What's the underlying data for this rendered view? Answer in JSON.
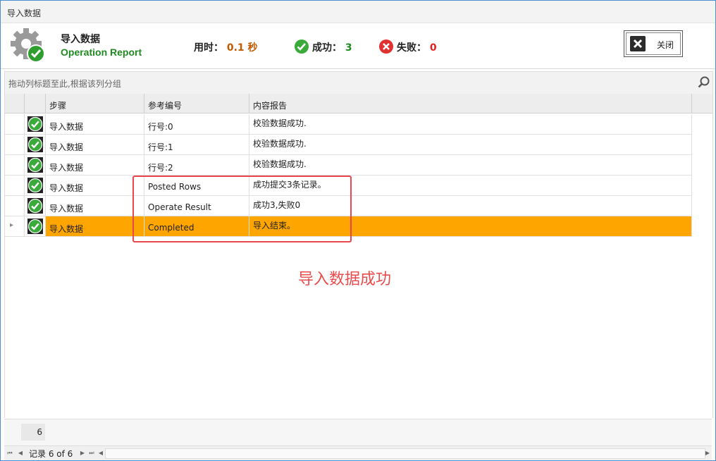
{
  "window": {
    "title": "导入数据"
  },
  "header": {
    "title": "导入数据",
    "subtitle": "Operation Report",
    "time_label": "用时：",
    "time_value": "0.1 秒",
    "success_label": "成功：",
    "success_value": "3",
    "fail_label": "失败：",
    "fail_value": "0",
    "close_label": "关闭"
  },
  "groupbar": {
    "hint": "拖动列标题至此,根据该列分组"
  },
  "grid": {
    "columns": [
      "步骤",
      "参考编号",
      "内容报告"
    ],
    "rows": [
      {
        "step": "导入数据",
        "ref": "行号:0",
        "report": "校验数据成功."
      },
      {
        "step": "导入数据",
        "ref": "行号:1",
        "report": "校验数据成功."
      },
      {
        "step": "导入数据",
        "ref": "行号:2",
        "report": "校验数据成功."
      },
      {
        "step": "导入数据",
        "ref": "Posted Rows",
        "report": "成功提交3条记录。"
      },
      {
        "step": "导入数据",
        "ref": "Operate Result",
        "report": "成功3,失败0"
      },
      {
        "step": "导入数据",
        "ref": "Completed",
        "report": "导入结束。"
      }
    ]
  },
  "annotation": {
    "text": "导入数据成功"
  },
  "footer": {
    "count": "6",
    "record_text": "记录 6 of 6"
  },
  "colors": {
    "selected_row": "#ffa500",
    "success": "#1f8a1f",
    "fail": "#e02020",
    "annotation": "#e84c4c"
  }
}
